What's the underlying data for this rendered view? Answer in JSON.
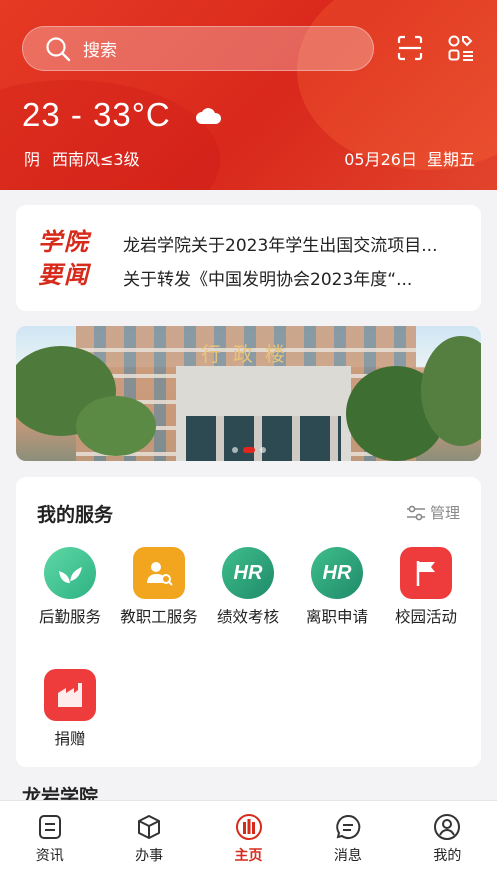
{
  "header": {
    "search_placeholder": "搜索",
    "temperature": "23 - 33°C",
    "weather": "阴",
    "wind": "西南风≤3级",
    "date": "05月26日",
    "weekday": "星期五"
  },
  "news": {
    "logo_line1": "学院",
    "logo_line2": "要闻",
    "items": [
      "龙岩学院关于2023年学生出国交流项目...",
      "关于转发《中国发明协会2023年度“..."
    ]
  },
  "banner": {
    "sign_text": "行政楼",
    "slides": 3,
    "active_slide": 2
  },
  "services": {
    "title": "我的服务",
    "manage_label": "管理",
    "items": [
      {
        "label": "后勤服务",
        "icon": "leaf-icon",
        "color": "#3fbf8c"
      },
      {
        "label": "教职工服务",
        "icon": "staff-search-icon",
        "color": "#f0a020"
      },
      {
        "label": "绩效考核",
        "icon": "hr-icon",
        "color": "#2a9a78"
      },
      {
        "label": "离职申请",
        "icon": "hr-icon",
        "color": "#2a9a78"
      },
      {
        "label": "校园活动",
        "icon": "flag-icon",
        "color": "#ee3b3b"
      },
      {
        "label": "捐赠",
        "icon": "factory-icon",
        "color": "#ee3b3b"
      }
    ]
  },
  "section_peek": "龙岩学院",
  "tabbar": {
    "items": [
      {
        "label": "资讯",
        "icon": "news-icon"
      },
      {
        "label": "办事",
        "icon": "cube-icon"
      },
      {
        "label": "主页",
        "icon": "home-logo-icon"
      },
      {
        "label": "消息",
        "icon": "message-icon"
      },
      {
        "label": "我的",
        "icon": "profile-icon"
      }
    ],
    "active": "主页"
  }
}
